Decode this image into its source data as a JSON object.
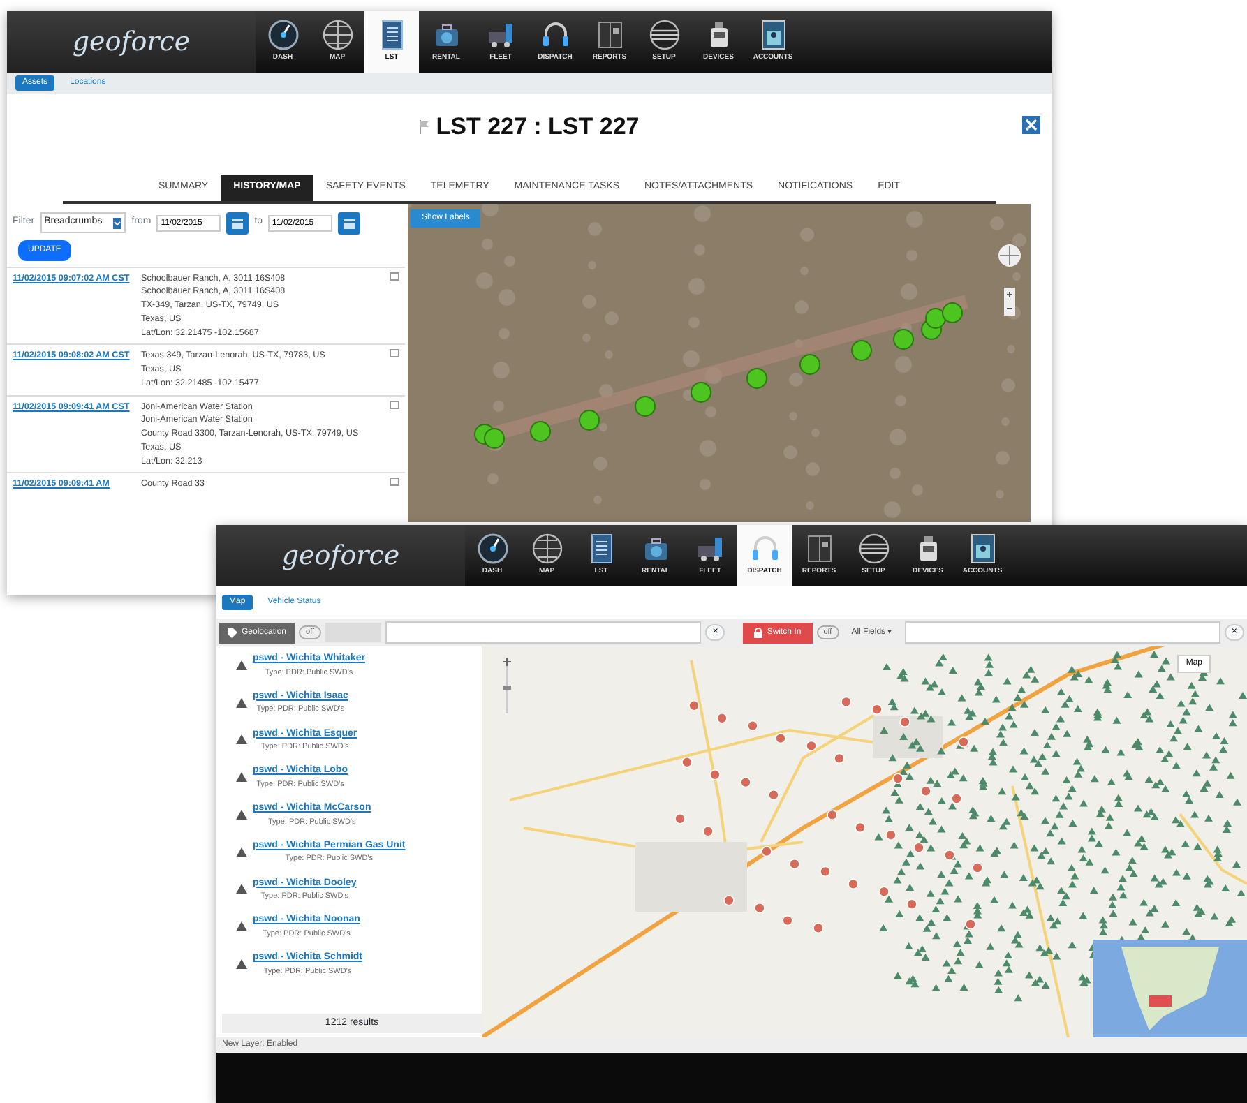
{
  "back_window": {
    "logo": "geoforce",
    "nav": [
      {
        "label": "DASH",
        "selected": false
      },
      {
        "label": "MAP",
        "selected": false
      },
      {
        "label": "LST",
        "selected": true
      },
      {
        "label": "RENTAL",
        "selected": false
      },
      {
        "label": "FLEET",
        "selected": false
      },
      {
        "label": "DISPATCH",
        "selected": false
      },
      {
        "label": "REPORTS",
        "selected": false
      },
      {
        "label": "SETUP",
        "selected": false
      },
      {
        "label": "DEVICES",
        "selected": false
      },
      {
        "label": "ACCOUNTS",
        "selected": false
      }
    ],
    "subnav": [
      {
        "label": "Assets",
        "selected": true
      },
      {
        "label": "Locations",
        "selected": false
      }
    ],
    "title": "LST 227 : LST 227",
    "tabs": [
      {
        "label": "SUMMARY",
        "selected": false
      },
      {
        "label": "HISTORY/MAP",
        "selected": true
      },
      {
        "label": "SAFETY EVENTS",
        "selected": false
      },
      {
        "label": "TELEMETRY",
        "selected": false
      },
      {
        "label": "MAINTENANCE TASKS",
        "selected": false
      },
      {
        "label": "NOTES/ATTACHMENTS",
        "selected": false
      },
      {
        "label": "NOTIFICATIONS",
        "selected": false
      },
      {
        "label": "EDIT",
        "selected": false
      }
    ],
    "filter": {
      "label": "Filter",
      "value": "Breadcrumbs",
      "from_label": "from",
      "from": "11/02/2015",
      "to_label": "to",
      "to": "11/02/2015"
    },
    "update_button": "UPDATE",
    "history": [
      {
        "time": "11/02/2015 09:07:02 AM CST",
        "lines": [
          "Schoolbauer Ranch, A, 3011 16S408",
          "Schoolbauer Ranch, A, 3011 16S408",
          "TX-349, Tarzan, US-TX, 79749, US",
          "Texas, US",
          "Lat/Lon: 32.21475 -102.15687"
        ]
      },
      {
        "time": "11/02/2015 09:08:02 AM CST",
        "lines": [
          "Texas 349, Tarzan-Lenorah, US-TX, 79783, US",
          "Texas, US",
          "Lat/Lon: 32.21485 -102.15477"
        ]
      },
      {
        "time": "11/02/2015 09:09:41 AM CST",
        "lines": [
          "Joni-American Water Station",
          "Joni-American Water Station",
          "County Road 3300, Tarzan-Lenorah, US-TX, 79749, US",
          "Texas, US",
          "Lat/Lon: 32.213"
        ]
      },
      {
        "time": "11/02/2015 09:09:41 AM",
        "lines": [
          "County Road 33"
        ]
      }
    ],
    "map": {
      "labels_button": "Show Labels"
    }
  },
  "front_window": {
    "logo": "geoforce",
    "nav": [
      {
        "label": "DASH",
        "selected": false
      },
      {
        "label": "MAP",
        "selected": false
      },
      {
        "label": "LST",
        "selected": false
      },
      {
        "label": "RENTAL",
        "selected": false
      },
      {
        "label": "FLEET",
        "selected": false
      },
      {
        "label": "DISPATCH",
        "selected": true
      },
      {
        "label": "REPORTS",
        "selected": false
      },
      {
        "label": "SETUP",
        "selected": false
      },
      {
        "label": "DEVICES",
        "selected": false
      },
      {
        "label": "ACCOUNTS",
        "selected": false
      }
    ],
    "subnav": [
      {
        "label": "Map",
        "selected": true
      },
      {
        "label": "Vehicle Status",
        "selected": false
      }
    ],
    "toolbar": {
      "location_button": "Geolocation",
      "left_toggle": {
        "label": "off",
        "on": false
      },
      "clear_left": "×",
      "switch_button": "Switch In",
      "right_toggle": {
        "label": "off",
        "on": false
      },
      "fields_select": "All Fields ▾",
      "clear_right": "×"
    },
    "results": [
      {
        "title": "pswd - Wichita Whitaker",
        "subtitle": "Type: PDR: Public SWD's"
      },
      {
        "title": "pswd - Wichita Isaac",
        "subtitle": "Type: PDR: Public SWD's"
      },
      {
        "title": "pswd - Wichita Esquer",
        "subtitle": "Type: PDR: Public SWD's"
      },
      {
        "title": "pswd - Wichita Lobo",
        "subtitle": "Type: PDR: Public SWD's"
      },
      {
        "title": "pswd - Wichita McCarson",
        "subtitle": "Type: PDR: Public SWD's"
      },
      {
        "title": "pswd - Wichita Permian Gas Unit",
        "subtitle": "Type: PDR: Public SWD's"
      },
      {
        "title": "pswd - Wichita Dooley",
        "subtitle": "Type: PDR: Public SWD's"
      },
      {
        "title": "pswd - Wichita Noonan",
        "subtitle": "Type: PDR: Public SWD's"
      },
      {
        "title": "pswd - Wichita Schmidt",
        "subtitle": "Type: PDR: Public SWD's"
      }
    ],
    "results_count": "1212 results",
    "map": {
      "map_type_button": "Map"
    },
    "status": "New Layer: Enabled"
  }
}
